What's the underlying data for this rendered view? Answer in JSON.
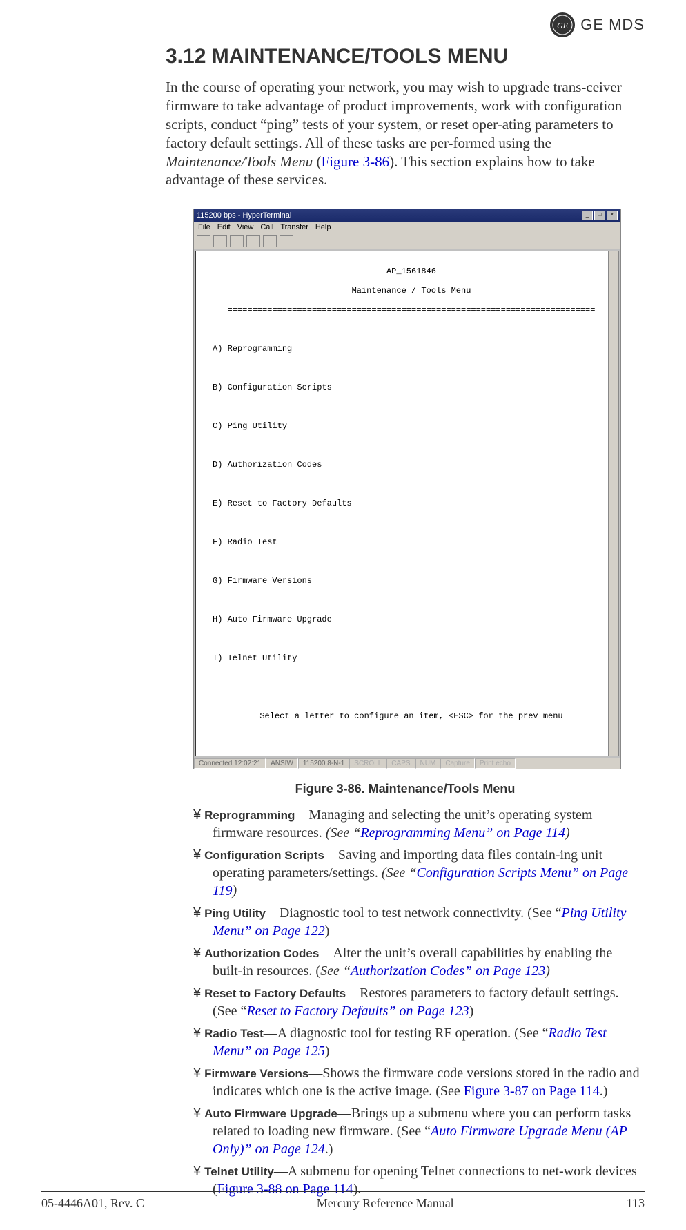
{
  "brand": {
    "ge_initials": "GE",
    "mds": "GE MDS"
  },
  "section": {
    "number_title": "3.12  MAINTENANCE/TOOLS MENU"
  },
  "intro": {
    "p1a": "In the course of operating your network, you may wish to upgrade trans-ceiver firmware to take advantage of product improvements, work with configuration scripts, conduct “ping” tests of your system, or reset oper-ating parameters to factory default settings. All of these tasks are per-formed using the ",
    "p1_italic": "Maintenance/Tools Menu",
    "p1b": " (",
    "p1_link": "Figure 3-86",
    "p1c": "). This section explains how to take advantage of these services."
  },
  "terminal": {
    "title": "115200 bps - HyperTerminal",
    "menus": [
      "File",
      "Edit",
      "View",
      "Call",
      "Transfer",
      "Help"
    ],
    "ap_line": "AP_1561846",
    "menu_title": "Maintenance / Tools Menu",
    "divider": "==========================================================================",
    "options": [
      "A) Reprogramming",
      "B) Configuration Scripts",
      "C) Ping Utility",
      "D) Authorization Codes",
      "E) Reset to Factory Defaults",
      "F) Radio Test",
      "G) Firmware Versions",
      "H) Auto Firmware Upgrade",
      "I) Telnet Utility"
    ],
    "prompt": "Select a letter to configure an item, <ESC> for the prev menu",
    "status": {
      "connected": "Connected 12:02:21",
      "emulation": "ANSIW",
      "baud": "115200 8-N-1",
      "scroll": "SCROLL",
      "caps": "CAPS",
      "num": "NUM",
      "capture": "Capture",
      "print": "Print echo"
    }
  },
  "figure_caption": "Figure 3-86. Maintenance/Tools Menu",
  "bullet_char": "¥",
  "items": [
    {
      "title": "Reprogramming",
      "text": "—Managing and selecting the unit’s operating system firmware resources. ",
      "see_prefix_italic": "(See “",
      "link": "Reprogramming Menu” on Page 114",
      "see_suffix_italic": ")"
    },
    {
      "title": "Configuration Scripts",
      "text": "—Saving and importing data files contain-ing unit operating parameters/settings. ",
      "see_prefix_italic": "(See “",
      "link": "Configuration Scripts Menu” on Page 119",
      "see_suffix_italic": ")"
    },
    {
      "title": "Ping Utility",
      "text": "—Diagnostic tool to test network connectivity. (",
      "see_prefix": "See “",
      "link": "Ping Utility Menu” on Page 122",
      "see_suffix": ")"
    },
    {
      "title": "Authorization Codes",
      "text": "—Alter the unit’s overall capabilities by enabling the built-in resources. (",
      "see_prefix_italic2": "See “",
      "link": "Authorization Codes” on Page 123",
      "see_suffix_italic": ")"
    },
    {
      "title": "Reset to Factory Defaults",
      "text": "—Restores parameters to factory default settings. (",
      "see_prefix": "See “",
      "link": "Reset to Factory Defaults” on Page 123",
      "see_suffix": ")"
    },
    {
      "title": "Radio Test",
      "text": "—A diagnostic tool for testing RF operation. (",
      "see_prefix": "See “",
      "link": "Radio Test Menu” on Page 125",
      "see_suffix": ")"
    },
    {
      "title": "Firmware Versions",
      "text": "—Shows the firmware code versions stored in the radio and indicates which one is the active image. (See ",
      "link": "Figure 3-87 on Page 114",
      "see_suffix": ".)"
    },
    {
      "title": "Auto Firmware Upgrade",
      "text": "—Brings up a submenu where you can perform tasks related to loading new firmware. (",
      "see_prefix": "See “",
      "link": "Auto Firmware Upgrade Menu (AP Only)” on Page 124",
      "see_suffix": ".)"
    },
    {
      "title": "Telnet Utility",
      "text": "—A submenu for opening Telnet connections to net-work devices (",
      "link": "Figure 3-88 on Page 114",
      "see_suffix": ")."
    }
  ],
  "footer": {
    "left": "05-4446A01, Rev. C",
    "center": "Mercury Reference Manual",
    "right": "113"
  }
}
